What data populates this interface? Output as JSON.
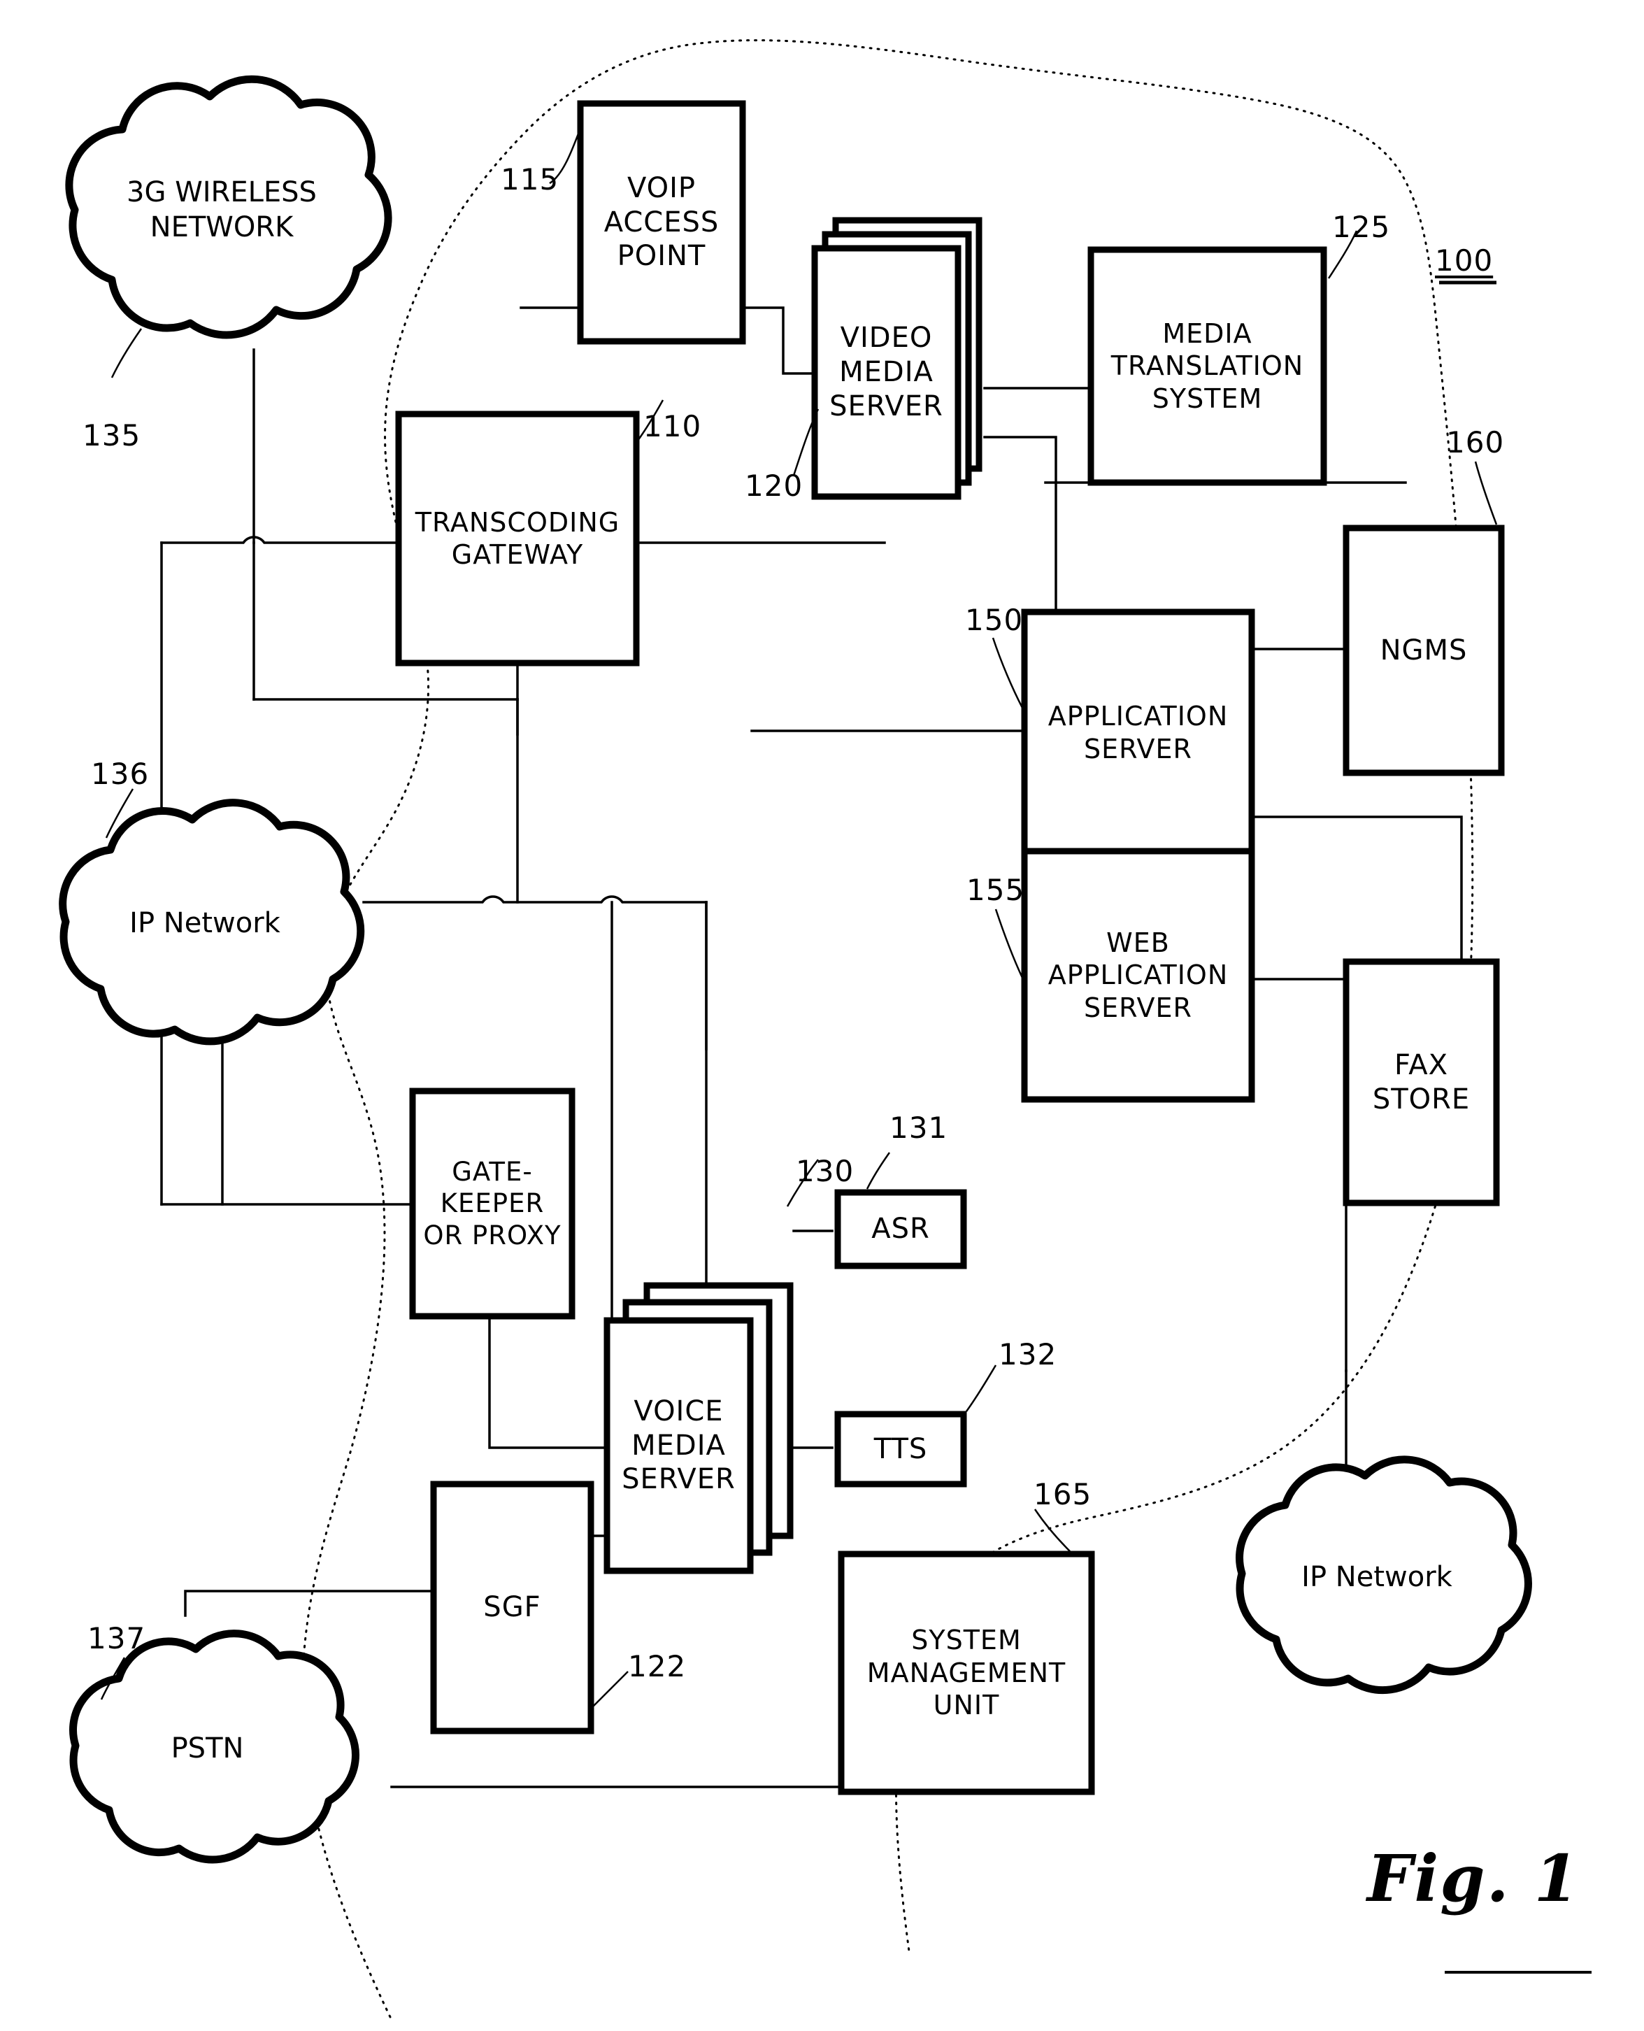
{
  "figure": {
    "caption": "Fig. 1",
    "system_ref": "100"
  },
  "nodes": [
    {
      "id": "voip_access_point",
      "label": "VOIP\nACCESS\nPOINT",
      "ref": "115",
      "shape": "box"
    },
    {
      "id": "video_media_server",
      "label": "VIDEO\nMEDIA\nSERVER",
      "ref": "120",
      "shape": "stacked-box"
    },
    {
      "id": "media_translation",
      "label": "MEDIA\nTRANSLATION\nSYSTEM",
      "ref": "125",
      "shape": "box"
    },
    {
      "id": "transcoding_gateway",
      "label": "TRANSCODING\nGATEWAY",
      "ref": "110",
      "shape": "box"
    },
    {
      "id": "application_server",
      "label": "APPLICATION\nSERVER",
      "ref": "150",
      "shape": "box"
    },
    {
      "id": "web_application_server",
      "label": "WEB\nAPPLICATION\nSERVER",
      "ref": "155",
      "shape": "box"
    },
    {
      "id": "ngms",
      "label": "NGMS",
      "ref": "160",
      "shape": "box"
    },
    {
      "id": "fax_store",
      "label": "FAX\nSTORE",
      "ref": "",
      "shape": "box"
    },
    {
      "id": "gatekeeper_or_proxy",
      "label": "GATE-\nKEEPER\nOR PROXY",
      "ref": "",
      "shape": "box"
    },
    {
      "id": "voice_media_server",
      "label": "VOICE\nMEDIA\nSERVER",
      "ref": "130",
      "shape": "stacked-box"
    },
    {
      "id": "asr",
      "label": "ASR",
      "ref": "131",
      "shape": "box"
    },
    {
      "id": "tts",
      "label": "TTS",
      "ref": "132",
      "shape": "box"
    },
    {
      "id": "system_management_unit",
      "label": "SYSTEM\nMANAGEMENT\nUNIT",
      "ref": "165",
      "shape": "box"
    },
    {
      "id": "sgf",
      "label": "SGF",
      "ref": "122",
      "shape": "box"
    }
  ],
  "clouds": [
    {
      "id": "wireless_network_cloud",
      "label": "3G WIRELESS\nNETWORK",
      "ref": "135"
    },
    {
      "id": "ip_network_left_cloud",
      "label": "IP Network",
      "ref": "136"
    },
    {
      "id": "pstn_cloud",
      "label": "PSTN",
      "ref": "137"
    },
    {
      "id": "ip_network_right_cloud",
      "label": "IP Network",
      "ref": ""
    }
  ],
  "ref_numbers": [
    {
      "id": "ref-115",
      "text": "115"
    },
    {
      "id": "ref-120",
      "text": "120"
    },
    {
      "id": "ref-125",
      "text": "125"
    },
    {
      "id": "ref-100",
      "text": "100"
    },
    {
      "id": "ref-110",
      "text": "110"
    },
    {
      "id": "ref-160",
      "text": "160"
    },
    {
      "id": "ref-150",
      "text": "150"
    },
    {
      "id": "ref-155",
      "text": "155"
    },
    {
      "id": "ref-135",
      "text": "135"
    },
    {
      "id": "ref-136",
      "text": "136"
    },
    {
      "id": "ref-137",
      "text": "137"
    },
    {
      "id": "ref-130",
      "text": "130"
    },
    {
      "id": "ref-131",
      "text": "131"
    },
    {
      "id": "ref-132",
      "text": "132"
    },
    {
      "id": "ref-165",
      "text": "165"
    },
    {
      "id": "ref-122",
      "text": "122"
    }
  ],
  "colors": {
    "line": "#000000",
    "background": "#ffffff"
  }
}
